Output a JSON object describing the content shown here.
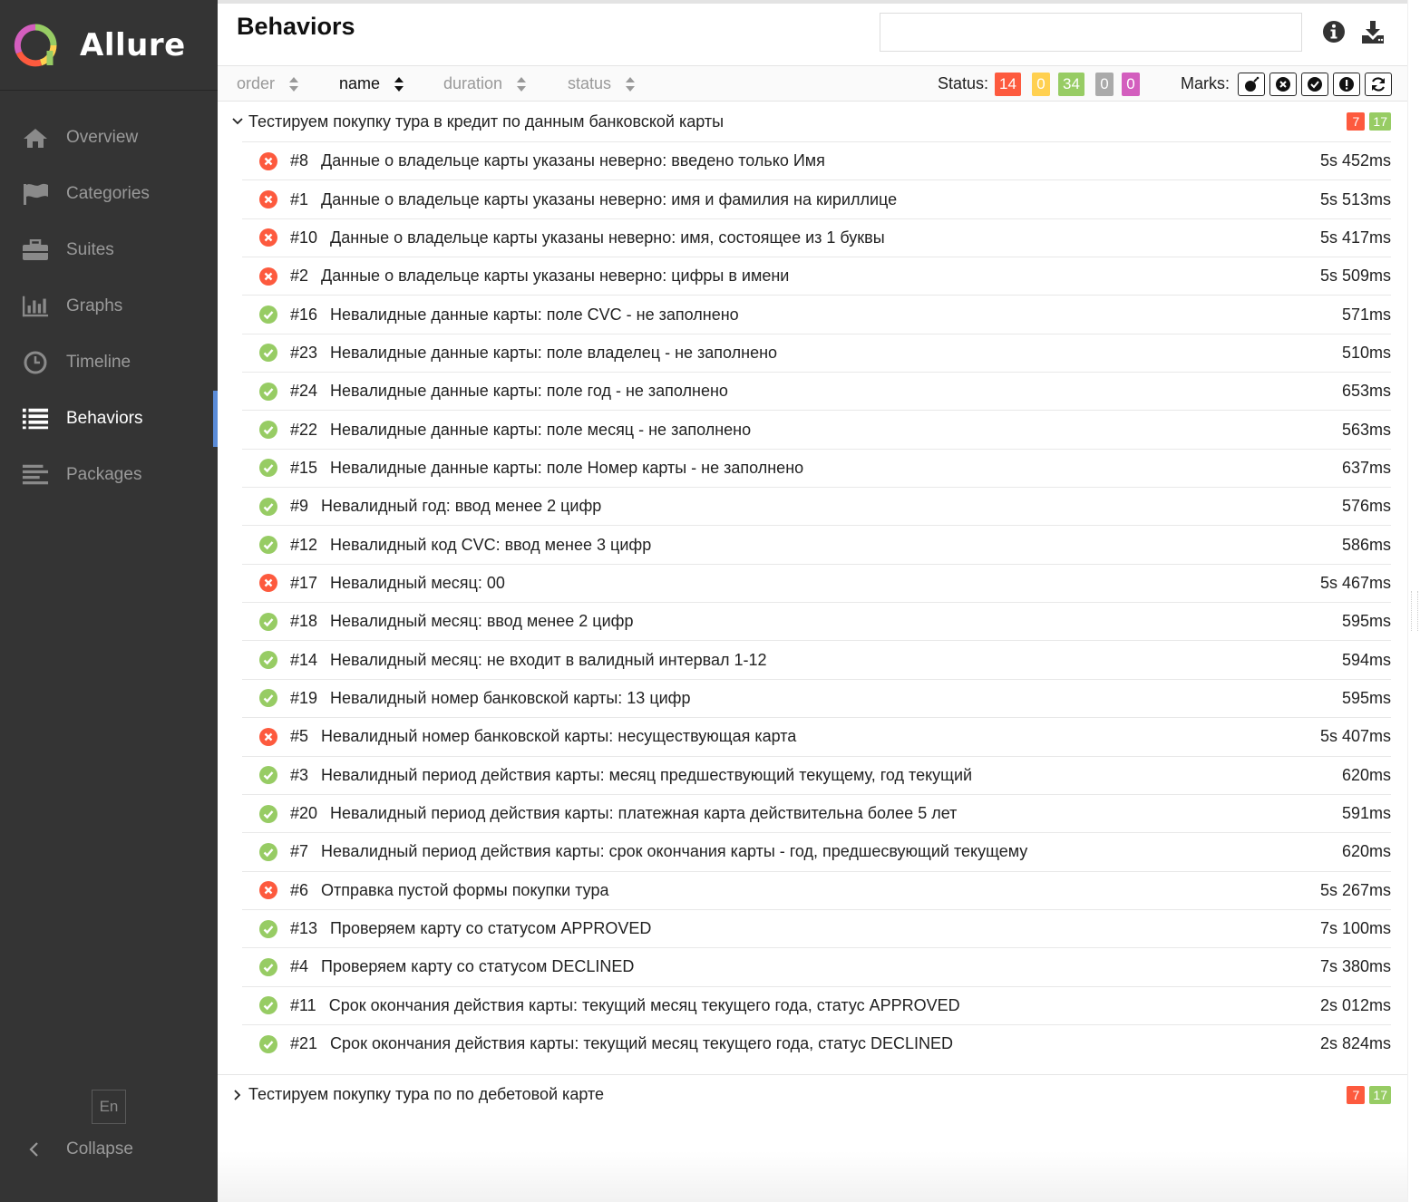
{
  "app": {
    "name": "Allure"
  },
  "sidebar": {
    "items": [
      {
        "label": "Overview",
        "icon": "home-icon"
      },
      {
        "label": "Categories",
        "icon": "flag-icon"
      },
      {
        "label": "Suites",
        "icon": "briefcase-icon"
      },
      {
        "label": "Graphs",
        "icon": "bar-chart-icon"
      },
      {
        "label": "Timeline",
        "icon": "clock-icon"
      },
      {
        "label": "Behaviors",
        "icon": "list-icon",
        "active": true
      },
      {
        "label": "Packages",
        "icon": "align-left-icon"
      }
    ],
    "language": "En",
    "collapse_label": "Collapse"
  },
  "pane": {
    "title": "Behaviors",
    "search_value": ""
  },
  "sort": {
    "order": "order",
    "name": "name",
    "duration": "duration",
    "status": "status"
  },
  "status_filter": {
    "label": "Status:",
    "counts": [
      "14",
      "0",
      "34",
      "0",
      "0"
    ],
    "colors": [
      "#fd5a3e",
      "#ffd050",
      "#97cc64",
      "#aaaaaa",
      "#d35ebe"
    ]
  },
  "marks": {
    "label": "Marks:",
    "icons": [
      "bomb-icon",
      "close-circle-icon",
      "check-circle-icon",
      "exclamation-icon",
      "refresh-icon"
    ]
  },
  "groups": [
    {
      "title": "Тестируем покупку тура в кредит по данным банковской карты",
      "failed": "7",
      "passed": "17",
      "expanded": true,
      "tests": [
        {
          "status": "failed",
          "num": "#8",
          "name": "Данные о владельце карты указаны неверно: введено только Имя",
          "duration": "5s 452ms"
        },
        {
          "status": "failed",
          "num": "#1",
          "name": "Данные о владельце карты указаны неверно: имя и фамилия на кириллице",
          "duration": "5s 513ms"
        },
        {
          "status": "failed",
          "num": "#10",
          "name": "Данные о владельце карты указаны неверно: имя, состоящее из 1 буквы",
          "duration": "5s 417ms"
        },
        {
          "status": "failed",
          "num": "#2",
          "name": "Данные о владельце карты указаны неверно: цифры в имени",
          "duration": "5s 509ms"
        },
        {
          "status": "passed",
          "num": "#16",
          "name": "Невалидные данные карты: поле CVC - не заполнено",
          "duration": "571ms"
        },
        {
          "status": "passed",
          "num": "#23",
          "name": "Невалидные данные карты: поле владелец - не заполнено",
          "duration": "510ms"
        },
        {
          "status": "passed",
          "num": "#24",
          "name": "Невалидные данные карты: поле год - не заполнено",
          "duration": "653ms"
        },
        {
          "status": "passed",
          "num": "#22",
          "name": "Невалидные данные карты: поле месяц - не заполнено",
          "duration": "563ms"
        },
        {
          "status": "passed",
          "num": "#15",
          "name": "Невалидные данные карты: поле Номер карты - не заполнено",
          "duration": "637ms"
        },
        {
          "status": "passed",
          "num": "#9",
          "name": "Невалидный год: ввод менее 2 цифр",
          "duration": "576ms"
        },
        {
          "status": "passed",
          "num": "#12",
          "name": "Невалидный код CVC: ввод менее 3 цифр",
          "duration": "586ms"
        },
        {
          "status": "failed",
          "num": "#17",
          "name": "Невалидный месяц: 00",
          "duration": "5s 467ms"
        },
        {
          "status": "passed",
          "num": "#18",
          "name": "Невалидный месяц: ввод менее 2 цифр",
          "duration": "595ms"
        },
        {
          "status": "passed",
          "num": "#14",
          "name": "Невалидный месяц: не входит в валидный интервал 1-12",
          "duration": "594ms"
        },
        {
          "status": "passed",
          "num": "#19",
          "name": "Невалидный номер банковской карты: 13 цифр",
          "duration": "595ms"
        },
        {
          "status": "failed",
          "num": "#5",
          "name": "Невалидный номер банковской карты: несуществующая карта",
          "duration": "5s 407ms"
        },
        {
          "status": "passed",
          "num": "#3",
          "name": "Невалидный период действия карты: месяц предшествующий текущему, год текущий",
          "duration": "620ms"
        },
        {
          "status": "passed",
          "num": "#20",
          "name": "Невалидный период действия карты: платежная карта действительна более 5 лет",
          "duration": "591ms"
        },
        {
          "status": "passed",
          "num": "#7",
          "name": "Невалидный период действия карты: срок окончания карты - год, предшесвующий текущему",
          "duration": "620ms"
        },
        {
          "status": "failed",
          "num": "#6",
          "name": "Отправка пустой формы покупки тура",
          "duration": "5s 267ms"
        },
        {
          "status": "passed",
          "num": "#13",
          "name": "Проверяем карту со статусом APPROVED",
          "duration": "7s 100ms"
        },
        {
          "status": "passed",
          "num": "#4",
          "name": "Проверяем карту со статусом DECLINED",
          "duration": "7s 380ms"
        },
        {
          "status": "passed",
          "num": "#11",
          "name": "Срок окончания действия карты: текущий месяц текущего года, статус APPROVED",
          "duration": "2s 012ms"
        },
        {
          "status": "passed",
          "num": "#21",
          "name": "Срок окончания действия карты: текущий месяц текущего года, статус DECLINED",
          "duration": "2s 824ms"
        }
      ]
    },
    {
      "title": "Тестируем покупку тура по по дебетовой карте",
      "failed": "7",
      "passed": "17",
      "expanded": false,
      "tests": []
    }
  ]
}
